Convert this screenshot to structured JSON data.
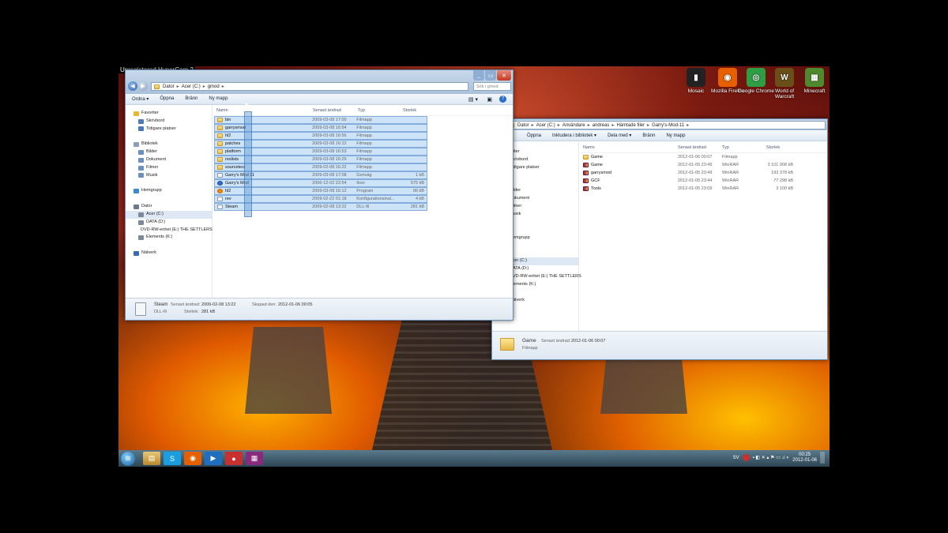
{
  "hypercam_label": "Unregistered HyperCam 2",
  "desktop_icons": [
    {
      "label": "Mosaic",
      "color": "#222222",
      "glyph": "▮"
    },
    {
      "label": "Mozilla Firefox",
      "color": "#e66000",
      "glyph": "◉"
    },
    {
      "label": "Google Chrome",
      "color": "#2e9e44",
      "glyph": "◎"
    },
    {
      "label": "World of Warcraft",
      "color": "#6a5018",
      "glyph": "W"
    },
    {
      "label": "Minecraft",
      "color": "#4f8a2f",
      "glyph": "▦"
    }
  ],
  "win1": {
    "search_placeholder": "Sök i gmod",
    "breadcrumb": [
      "Dator",
      "Acer (C:)",
      "gmod"
    ],
    "toolbar": [
      "Ordna ▾",
      "Öppna",
      "Bränn",
      "Ny mapp"
    ],
    "nav": {
      "favorites_header": "Favoriter",
      "favorites": [
        "Skrivbord",
        "Tidigare platser"
      ],
      "libraries_header": "Bibliotek",
      "libraries": [
        "Bilder",
        "Dokument",
        "Filmer",
        "Musik"
      ],
      "homegroup": "Hemgrupp",
      "computer_header": "Dator",
      "drives": [
        "Acer (C:)",
        "DATA (D:)",
        "DVD-RW-enhet (E:) THE SETTLERS",
        "Elements (K:)"
      ],
      "network": "Nätverk"
    },
    "columns": [
      "Namn",
      "Senast ändrad",
      "Typ",
      "Storlek"
    ],
    "rows": [
      {
        "name": "bin",
        "date": "2009-03-08 17:00",
        "type": "Filmapp",
        "size": "",
        "icon": "folder"
      },
      {
        "name": "garrysmod",
        "date": "2009-03-08 16:54",
        "type": "Filmapp",
        "size": "",
        "icon": "folder"
      },
      {
        "name": "hl2",
        "date": "2009-03-08 16:56",
        "type": "Filmapp",
        "size": "",
        "icon": "folder"
      },
      {
        "name": "patches",
        "date": "2009-03-08 16:12",
        "type": "Filmapp",
        "size": "",
        "icon": "folder"
      },
      {
        "name": "platform",
        "date": "2009-03-08 16:53",
        "type": "Filmapp",
        "size": "",
        "icon": "folder"
      },
      {
        "name": "reslists",
        "date": "2009-03-08 16:29",
        "type": "Filmapp",
        "size": "",
        "icon": "folder"
      },
      {
        "name": "sourcetest",
        "date": "2009-02-08 16:22",
        "type": "Filmapp",
        "size": "",
        "icon": "folder"
      },
      {
        "name": "Garry's Mod 11",
        "date": "2009-03-08 17:08",
        "type": "Genväg",
        "size": "1 kB",
        "icon": "file"
      },
      {
        "name": "Garry's Mod",
        "date": "2006-12-02 22:54",
        "type": "Ikon",
        "size": "575 kB",
        "icon": "gmod"
      },
      {
        "name": "hl2",
        "date": "2009-03-08 16:12",
        "type": "Program",
        "size": "96 kB",
        "icon": "hl2"
      },
      {
        "name": "rev",
        "date": "2009-02-22 01:18",
        "type": "Konfigurationsinst...",
        "size": "4 kB",
        "icon": "file"
      },
      {
        "name": "Steam",
        "date": "2009-02-08 13:22",
        "type": "DLL-fil",
        "size": "281 kB",
        "icon": "file"
      }
    ],
    "details": {
      "name": "Steam",
      "type": "DLL-fil",
      "modified_label": "Senast ändrad:",
      "modified": "2009-02-08 13:22",
      "created_label": "Skapad den:",
      "created": "2012-01-06 00:05",
      "size_label": "Storlek:",
      "size": "281 kB"
    }
  },
  "win2": {
    "breadcrumb": [
      "Dator",
      "Acer (C:)",
      "Användare",
      "andreas",
      "Hämtade filer",
      "Garry's-Mod-11"
    ],
    "toolbar": [
      "Öppna",
      "Inkludera i bibliotek ▾",
      "Dela med ▾",
      "Bränn",
      "Ny mapp"
    ],
    "nav": {
      "favorites_header": "nriter",
      "favorites": [
        "Skrivbord",
        "Tidigare platser"
      ],
      "libraries": [
        "Bilder",
        "Dokument",
        "Filmer",
        "Musik"
      ],
      "homegroup": "Hemgrupp",
      "drives": [
        "Acer (C:)",
        "DATA (D:)",
        "DVD-RW-enhet (E:) THE SETTLERS",
        "Elements (K:)"
      ],
      "network": "Nätverk"
    },
    "columns": [
      "Namn",
      "Senast ändrad",
      "Typ",
      "Storlek"
    ],
    "rows": [
      {
        "name": "Game",
        "date": "2012-01-06 00:07",
        "type": "Filmapp",
        "size": "",
        "icon": "folder"
      },
      {
        "name": "Game",
        "date": "2012-01-05 23:49",
        "type": "WinRAR",
        "size": "3 101 008 kB",
        "icon": "rar"
      },
      {
        "name": "garrysmod",
        "date": "2012-01-05 23:49",
        "type": "WinRAR",
        "size": "193 378 kB",
        "icon": "rar"
      },
      {
        "name": "GCF",
        "date": "2012-01-05 23:44",
        "type": "WinRAR",
        "size": "77 298 kB",
        "icon": "rar"
      },
      {
        "name": "Tools",
        "date": "2012-01-05 23:09",
        "type": "WinRAR",
        "size": "3 100 kB",
        "icon": "rar"
      }
    ],
    "details": {
      "name": "Game",
      "modified_label": "Senast ändrad:",
      "modified": "2012-01-06 00:07",
      "type": "Filmapp"
    }
  },
  "taskbar": {
    "lang": "SV",
    "time": "00:25",
    "date": "2012-01-06"
  }
}
